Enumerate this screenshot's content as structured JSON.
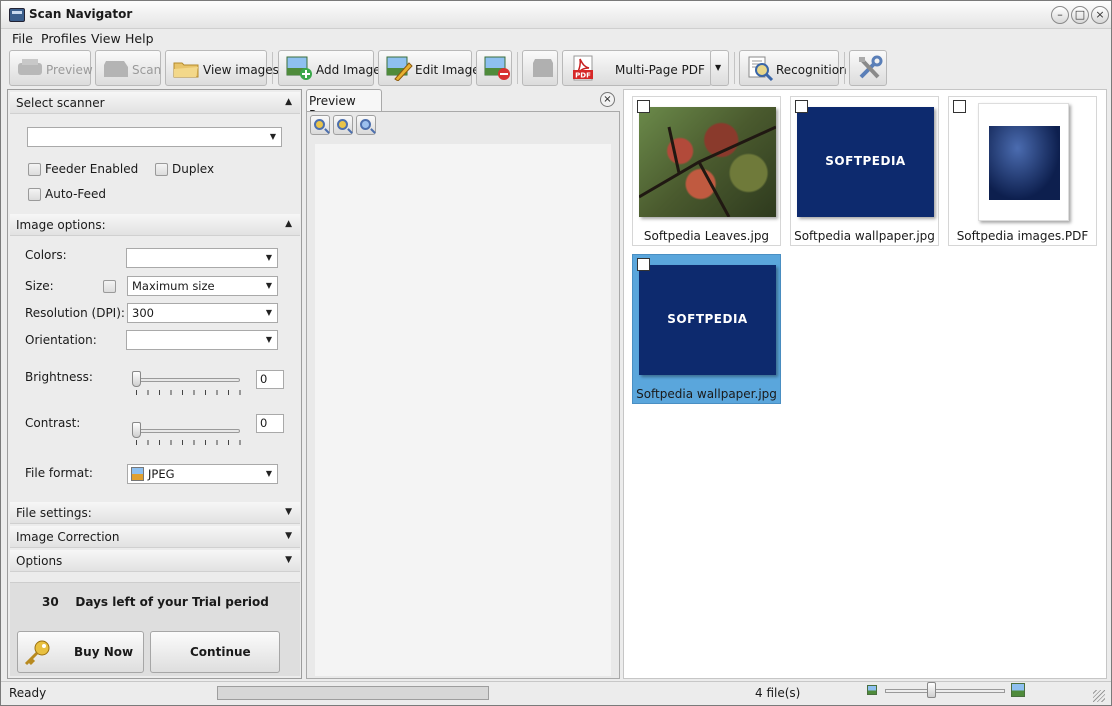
{
  "window": {
    "title": "Scan Navigator"
  },
  "menu": [
    "File",
    "Profiles",
    "View",
    "Help"
  ],
  "toolbar": {
    "preview": "Preview",
    "scan": "Scan",
    "view_images": "View images",
    "add_image": "Add Image",
    "edit_image": "Edit Image",
    "multi_page_pdf": "Multi-Page PDF",
    "pdf_badge": "PDF",
    "recognition": "Recognition"
  },
  "scanner": {
    "header": "Select scanner",
    "selected": "",
    "feeder_enabled": "Feeder Enabled",
    "duplex": "Duplex",
    "auto_feed": "Auto-Feed"
  },
  "image_options": {
    "header": "Image options:",
    "colors_label": "Colors:",
    "colors_value": "",
    "size_label": "Size:",
    "size_value": "Maximum size",
    "resolution_label": "Resolution (DPI):",
    "resolution_value": "300",
    "orientation_label": "Orientation:",
    "orientation_value": "",
    "brightness_label": "Brightness:",
    "brightness_value": "0",
    "contrast_label": "Contrast:",
    "contrast_value": "0",
    "file_format_label": "File format:",
    "file_format_value": "JPEG"
  },
  "sections": {
    "file_settings": "File settings:",
    "image_correction": "Image Correction",
    "options": "Options"
  },
  "trial": {
    "days": "30",
    "text": "Days left of your Trial period",
    "buy_now": "Buy Now",
    "continue": "Continue"
  },
  "preview_pane": {
    "tab": "Preview Pane"
  },
  "thumbnails": [
    {
      "caption": "Softpedia Leaves.jpg",
      "kind": "photo",
      "selected": false
    },
    {
      "caption": "Softpedia wallpaper.jpg",
      "kind": "softpedia",
      "selected": false,
      "logo": "SOFTPEDIA"
    },
    {
      "caption": "Softpedia images.PDF",
      "kind": "pdf",
      "selected": false
    },
    {
      "caption": "Softpedia wallpaper.jpg",
      "kind": "softpedia",
      "selected": true,
      "logo": "SOFTPEDIA"
    }
  ],
  "status": {
    "ready": "Ready",
    "files": "4 file(s)"
  },
  "colors": {
    "selection": "#5aa6dc",
    "softpedia_blue": "#0d2a6e"
  }
}
